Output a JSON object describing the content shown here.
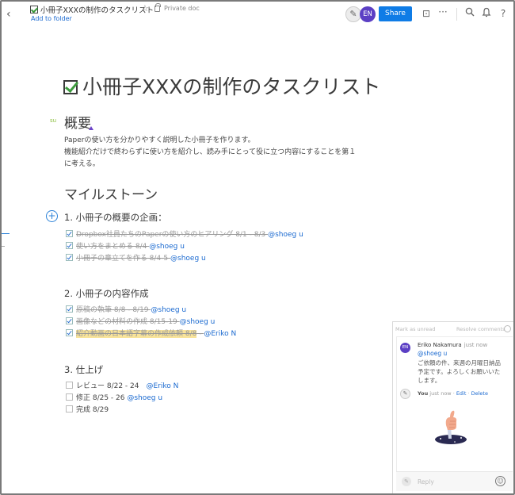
{
  "topbar": {
    "back_icon": "chevron-left-icon",
    "doc_title": "小冊子XXXの制作のタスクリスト",
    "star_icon": "☆",
    "privacy": "Private doc",
    "add_folder": "Add to folder",
    "avatar_me": "✎",
    "avatar_en": "EN",
    "share": "Share",
    "present_icon": "⊡",
    "more_icon": "···",
    "search_icon": "⌕",
    "bell_icon": "🔔",
    "help_icon": "?"
  },
  "doc": {
    "title": "小冊子XXXの制作のタスクリスト",
    "cursor_label": "su",
    "overview_heading": "概要",
    "overview_lines": [
      "Paperの使い方を分かりやすく説明した小冊子を作ります。",
      "機能紹介だけで終わらずに使い方を紹介し、読み手にとって役に立つ内容にすることを第１",
      "に考える。"
    ],
    "milestones_heading": "マイルストーン",
    "plus_icon": "+",
    "sections": [
      {
        "heading": "1. 小冊子の概要の企画：",
        "tasks": [
          {
            "text": "Dropbox社員たちのPaperの使い方のヒアリング 8/1 - 8/3 ",
            "mention": "@shoeg u"
          },
          {
            "text": "使い方をまとめる 8/4 ",
            "mention": "@shoeg u"
          },
          {
            "text": "小冊子の章立てを作る 8/4-5 ",
            "mention": "@shoeg u"
          }
        ]
      },
      {
        "heading": "2. 小冊子の内容作成",
        "tasks": [
          {
            "text": "原稿の執筆 8/8 - 8/19 ",
            "mention": "@shoeg u"
          },
          {
            "text": "画像などの材料の作成 8/15-19 ",
            "mention": "@shoeg u"
          },
          {
            "text": "紹介動画の日本語字幕の作成依頼 8/8",
            "text_tail": " - ",
            "mention": "@Eriko N"
          }
        ]
      },
      {
        "heading": "3. 仕上げ",
        "tasks": [
          {
            "text": "レビュー 8/22 - 24　",
            "mention": "@Eriko N"
          },
          {
            "text": "修正 8/25 - 26 ",
            "mention": "@shoeg u"
          },
          {
            "text": "完成 8/29",
            "mention": ""
          }
        ]
      }
    ]
  },
  "comments": {
    "mark_unread": "Mark as unread",
    "resolve": "Resolve comments",
    "author_avatar": "EN",
    "author": "Eriko Nakamura",
    "time": "just now",
    "mention": "@shoeg u",
    "body_lines": [
      "ご依頼の件、来週の月曜日納品",
      "予定です。よろしくお願いいた",
      "します。"
    ],
    "reply_avatar": "✎",
    "reply_author": "You",
    "reply_time": "just now",
    "edit": "Edit",
    "delete": "Delete",
    "reply_placeholder": "Reply",
    "emoji_icon": "☺"
  }
}
